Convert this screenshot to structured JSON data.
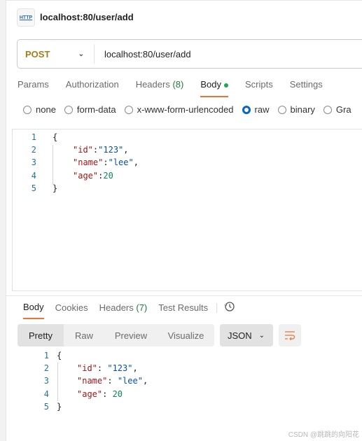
{
  "request": {
    "icon": "http-icon",
    "title": "localhost:80/user/add",
    "method": "POST",
    "url": "localhost:80/user/add",
    "tabs": [
      {
        "label": "Params"
      },
      {
        "label": "Authorization"
      },
      {
        "label": "Headers",
        "count": "(8)"
      },
      {
        "label": "Body"
      },
      {
        "label": "Scripts"
      },
      {
        "label": "Settings"
      }
    ],
    "body_types": [
      "none",
      "form-data",
      "x-www-form-urlencoded",
      "raw",
      "binary",
      "Gra"
    ],
    "selected_body_type": "raw",
    "code": {
      "lines": [
        "1",
        "2",
        "3",
        "4",
        "5"
      ],
      "open": "{",
      "close": "}",
      "k1": "\"id\"",
      "v1": "\"123\"",
      "k2": "\"name\"",
      "v2": "\"lee\"",
      "k3": "\"age\"",
      "v3": "20"
    }
  },
  "response": {
    "tabs": [
      {
        "label": "Body"
      },
      {
        "label": "Cookies"
      },
      {
        "label": "Headers",
        "count": "(7)"
      },
      {
        "label": "Test Results"
      }
    ],
    "views": [
      "Pretty",
      "Raw",
      "Preview",
      "Visualize"
    ],
    "active_view": "Pretty",
    "format": "JSON",
    "code": {
      "lines": [
        "1",
        "2",
        "3",
        "4",
        "5"
      ],
      "open": "{",
      "close": "}",
      "k1": "\"id\"",
      "v1": "\"123\"",
      "k2": "\"name\"",
      "v2": "\"lee\"",
      "k3": "\"age\"",
      "v3": "20"
    }
  },
  "watermark": "CSDN @跳跳的向阳花",
  "colors": {
    "accent": "#e8743b",
    "method": "#a67c1a",
    "radio": "#0b63c9",
    "dot": "#1aaa55"
  }
}
